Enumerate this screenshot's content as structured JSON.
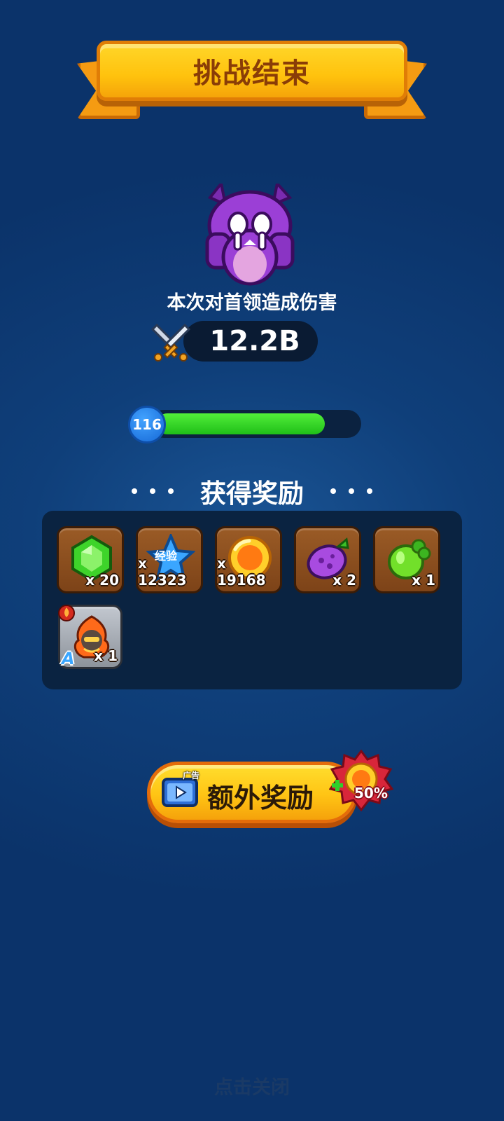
{
  "banner": {
    "title": "挑战结束"
  },
  "damage": {
    "label": "本次对首领造成伤害",
    "value": "12.2B"
  },
  "level": {
    "number": "116",
    "progress": 0.85
  },
  "rewards": {
    "title": "获得奖励",
    "items": [
      {
        "icon": "green-gem-icon",
        "qty": "x 20"
      },
      {
        "icon": "exp-star-icon",
        "badge": "经验",
        "qty": "x 12323"
      },
      {
        "icon": "gold-coin-icon",
        "qty": "x 19168"
      },
      {
        "icon": "purple-eggplant-icon",
        "qty": "x 2"
      },
      {
        "icon": "green-fruit-icon",
        "qty": "x 1"
      },
      {
        "icon": "fire-hero-icon",
        "rank": "A",
        "qty": "x 1"
      }
    ]
  },
  "extra": {
    "ad_tag": "广告",
    "label": "额外奖励",
    "bonus": "+50%",
    "bonus_pct": "50%"
  },
  "footer": {
    "close_hint": "点击关闭"
  },
  "colors": {
    "background": "#0f3f7a",
    "banner": "#ffc20d",
    "progress": "#2fd024",
    "button": "#ffc414"
  }
}
